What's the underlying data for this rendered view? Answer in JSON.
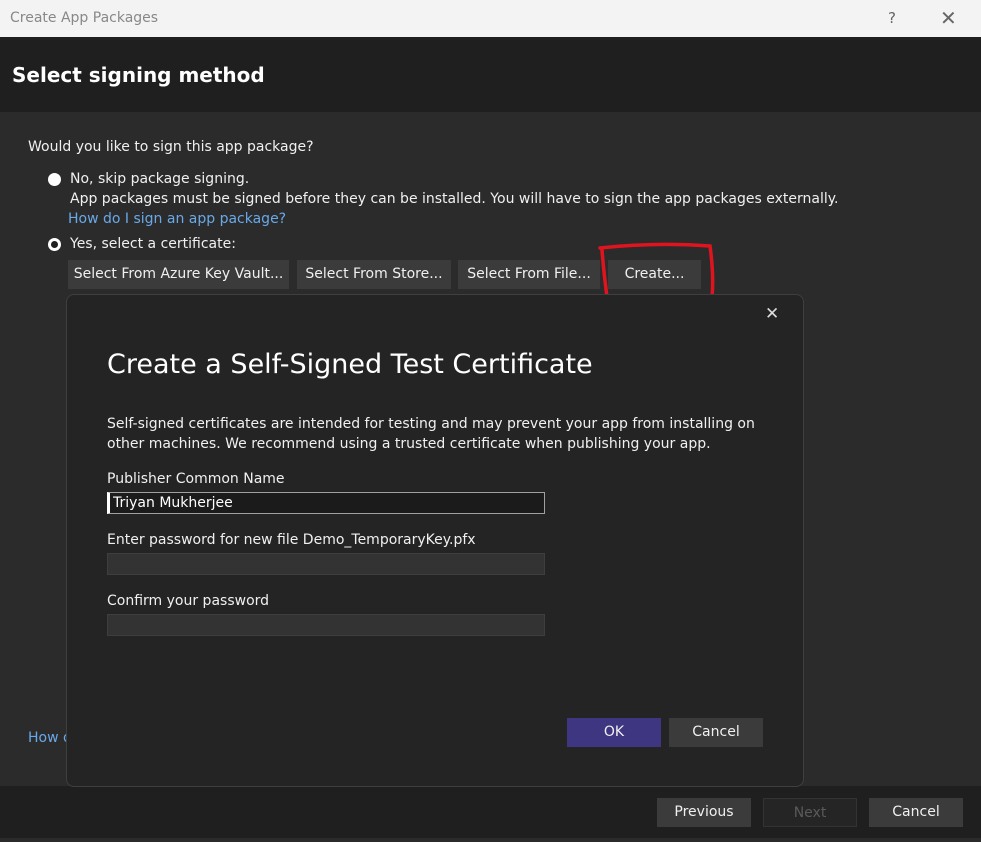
{
  "window": {
    "title": "Create App Packages",
    "help_label": "?",
    "close_label": "✕"
  },
  "header": {
    "title": "Select signing method"
  },
  "main": {
    "question": "Would you like to sign this app package?",
    "option_skip": {
      "label": "No, skip package signing.",
      "description": "App packages must be signed before they can be installed. You will have to sign the app packages externally.",
      "selected": false
    },
    "help_link": "How do I sign an app package?",
    "option_cert": {
      "label": "Yes, select a certificate:",
      "selected": true
    },
    "buttons": {
      "azure": "Select From Azure Key Vault...",
      "store": "Select From Store...",
      "file": "Select From File...",
      "create": "Create..."
    },
    "bottom_link_partial": "How d",
    "annotation_color": "#e0141e"
  },
  "dialog": {
    "close_label": "✕",
    "title": "Create a Self-Signed Test Certificate",
    "description_line1": "Self-signed certificates are intended for testing and may prevent your app from installing on",
    "description_line2": "other machines. We recommend using a trusted certificate when publishing your app.",
    "publisher_label": "Publisher Common Name",
    "publisher_value": "Triyan Mukherjee",
    "password_label": "Enter password for new file Demo_TemporaryKey.pfx",
    "password_value": "",
    "confirm_label": "Confirm your password",
    "confirm_value": "",
    "ok_label": "OK",
    "cancel_label": "Cancel",
    "accent_color": "#3f3682"
  },
  "footer": {
    "previous": "Previous",
    "next": "Next",
    "cancel": "Cancel",
    "next_enabled": false
  }
}
